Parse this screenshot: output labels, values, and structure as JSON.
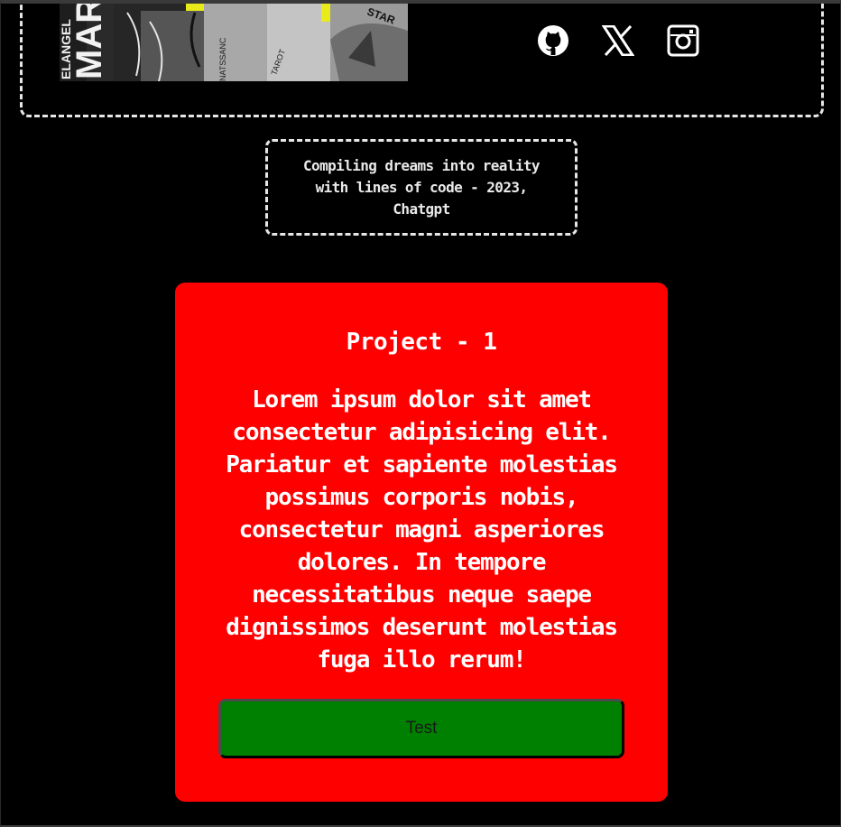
{
  "header": {
    "hero_image": {
      "alt": "collage artwork",
      "visible_text": [
        "ELANGEL",
        "MAR",
        "STAR",
        "TAROT",
        "NATSSANC"
      ]
    },
    "socials": [
      {
        "name": "github",
        "icon": "github-icon"
      },
      {
        "name": "x",
        "icon": "x-icon"
      },
      {
        "name": "instagram",
        "icon": "instagram-icon"
      }
    ]
  },
  "quote": {
    "text": "Compiling dreams into reality with lines of code - 2023, Chatgpt"
  },
  "project": {
    "title": "Project - 1",
    "description": "Lorem ipsum dolor sit amet consectetur adipisicing elit. Pariatur et sapiente molestias possimus corporis nobis, consectetur magni asperiores dolores. In tempore necessitatibus neque saepe dignissimos deserunt molestias fuga illo rerum!",
    "button_label": "Test"
  },
  "colors": {
    "background": "#000000",
    "card": "#ff0000",
    "button": "#008000",
    "accent_yellow": "#f5f211",
    "border": "#e6e6e6"
  }
}
